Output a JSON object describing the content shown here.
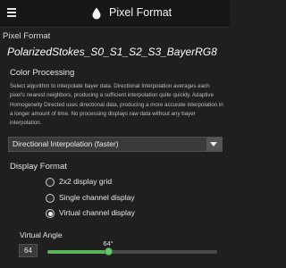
{
  "header": {
    "title": "Pixel Format",
    "menu_icon": "hamburger-menu-icon",
    "title_icon": "droplet-icon"
  },
  "pixel_format": {
    "label": "Pixel Format",
    "value": "PolarizedStokes_S0_S1_S2_S3_BayerRG8"
  },
  "color_processing": {
    "heading": "Color Processing",
    "description": "Select algorithm to interpolate bayer data. Directional Interpolation averages each pixel's nearest neighbors, producing a sufficient interpolation quite quickly. Adaptive Homogeneity Directed uses directional data, producing a more accurate interpolation in a longer amount of time. No processing displays raw data without any bayer interpolation.",
    "selected": "Directional Interpolation (faster)"
  },
  "display_format": {
    "heading": "Display Format",
    "options": [
      {
        "label": "2x2 display grid",
        "selected": false
      },
      {
        "label": "Single channel display",
        "selected": false
      },
      {
        "label": "Virtual channel display",
        "selected": true
      }
    ]
  },
  "virtual_angle": {
    "heading": "Virtual Angle",
    "value": "64",
    "slider_label": "64°",
    "level": 64,
    "min": 0,
    "max": 180
  },
  "colors": {
    "background": "#1f1f1f",
    "titlebar": "#161616",
    "accent": "#5bb45a"
  }
}
